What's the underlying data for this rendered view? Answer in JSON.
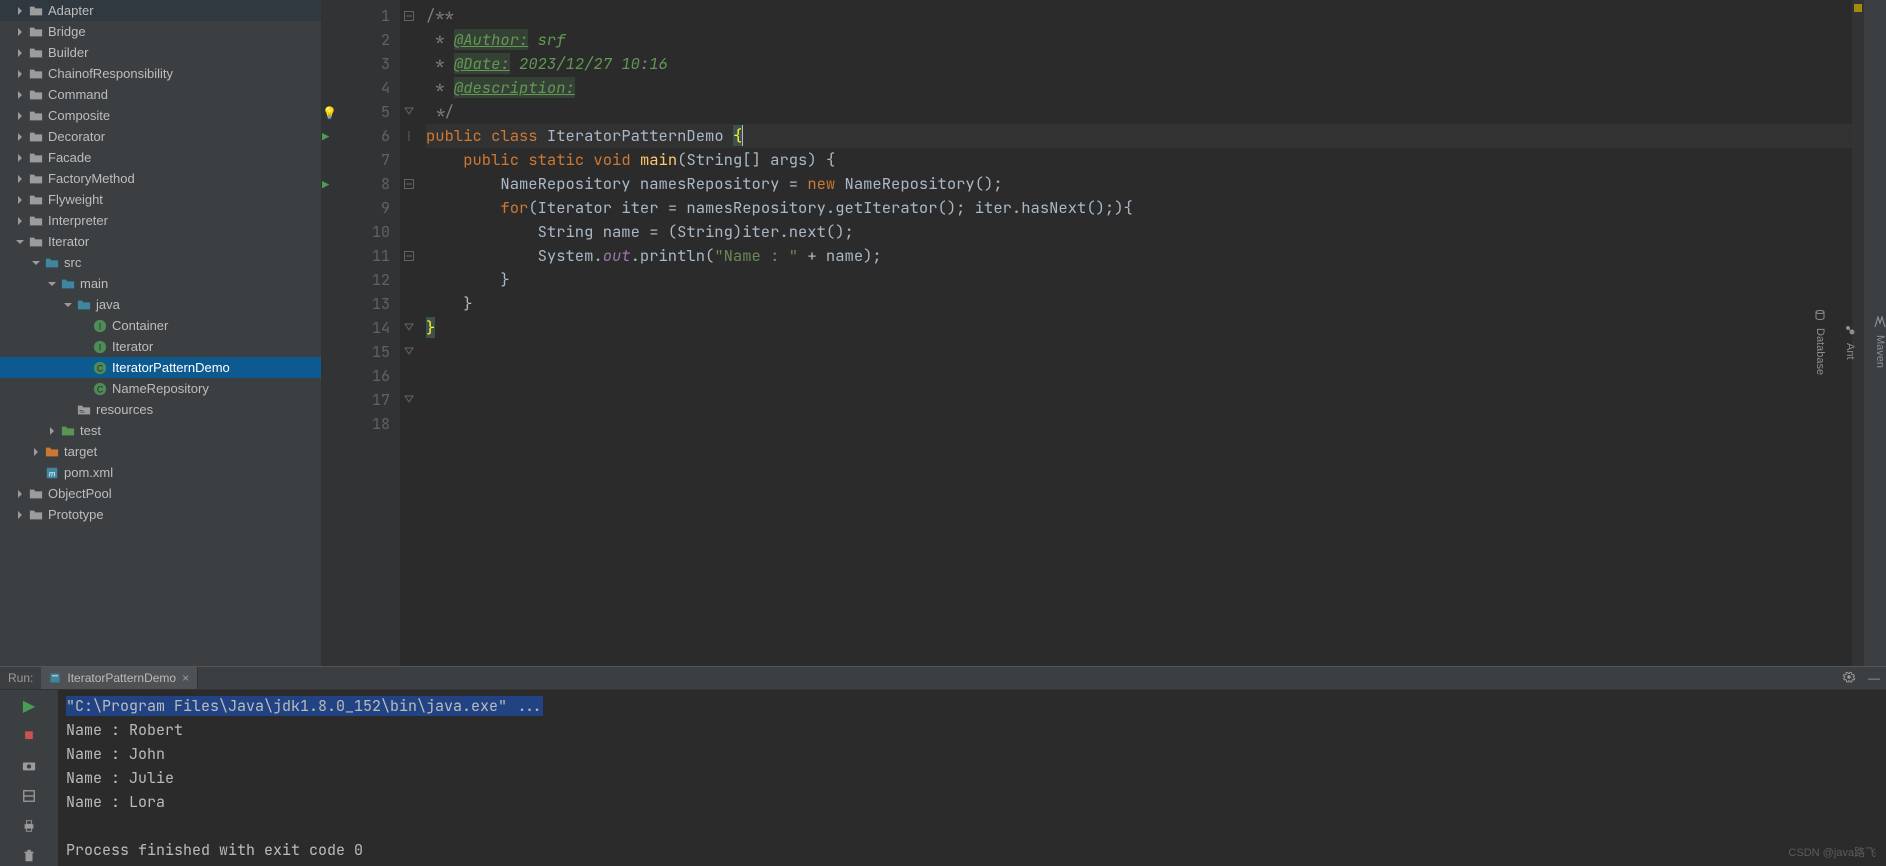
{
  "tree": [
    {
      "indent": 0,
      "arrow": "right",
      "icon": "folder",
      "label": "Adapter"
    },
    {
      "indent": 0,
      "arrow": "right",
      "icon": "folder",
      "label": "Bridge"
    },
    {
      "indent": 0,
      "arrow": "right",
      "icon": "folder",
      "label": "Builder"
    },
    {
      "indent": 0,
      "arrow": "right",
      "icon": "folder",
      "label": "ChainofResponsibility"
    },
    {
      "indent": 0,
      "arrow": "right",
      "icon": "folder",
      "label": "Command"
    },
    {
      "indent": 0,
      "arrow": "right",
      "icon": "folder",
      "label": "Composite"
    },
    {
      "indent": 0,
      "arrow": "right",
      "icon": "folder",
      "label": "Decorator"
    },
    {
      "indent": 0,
      "arrow": "right",
      "icon": "folder",
      "label": "Facade"
    },
    {
      "indent": 0,
      "arrow": "right",
      "icon": "folder",
      "label": "FactoryMethod"
    },
    {
      "indent": 0,
      "arrow": "right",
      "icon": "folder",
      "label": "Flyweight"
    },
    {
      "indent": 0,
      "arrow": "right",
      "icon": "folder",
      "label": "Interpreter"
    },
    {
      "indent": 0,
      "arrow": "down",
      "icon": "folder",
      "label": "Iterator"
    },
    {
      "indent": 1,
      "arrow": "down",
      "icon": "src",
      "label": "src"
    },
    {
      "indent": 2,
      "arrow": "down",
      "icon": "src",
      "label": "main"
    },
    {
      "indent": 3,
      "arrow": "down",
      "icon": "src",
      "label": "java"
    },
    {
      "indent": 4,
      "arrow": "none",
      "icon": "iface",
      "label": "Container"
    },
    {
      "indent": 4,
      "arrow": "none",
      "icon": "iface",
      "label": "Iterator"
    },
    {
      "indent": 4,
      "arrow": "none",
      "icon": "class",
      "label": "IteratorPatternDemo",
      "selected": true
    },
    {
      "indent": 4,
      "arrow": "none",
      "icon": "class",
      "label": "NameRepository"
    },
    {
      "indent": 3,
      "arrow": "none",
      "icon": "res",
      "label": "resources"
    },
    {
      "indent": 2,
      "arrow": "right",
      "icon": "test",
      "label": "test"
    },
    {
      "indent": 1,
      "arrow": "right",
      "icon": "target",
      "label": "target"
    },
    {
      "indent": 1,
      "arrow": "none",
      "icon": "pom",
      "label": "pom.xml"
    },
    {
      "indent": 0,
      "arrow": "right",
      "icon": "folder",
      "label": "ObjectPool"
    },
    {
      "indent": 0,
      "arrow": "right",
      "icon": "folder",
      "label": "Prototype"
    }
  ],
  "editor": {
    "line_numbers": [
      1,
      2,
      3,
      4,
      5,
      6,
      7,
      8,
      9,
      10,
      11,
      12,
      13,
      14,
      15,
      16,
      17,
      18
    ],
    "gutter_icons": {
      "5": "bulb",
      "6": "run",
      "8": "run"
    },
    "fold": {
      "1": "open",
      "5": "close",
      "6": "line",
      "8": "open",
      "11": "open",
      "14": "close",
      "15": "close",
      "17": "close"
    },
    "lines": [
      [
        {
          "t": "/**",
          "c": "cmt"
        }
      ],
      [
        {
          "t": " * ",
          "c": "cmt"
        },
        {
          "t": "@Author:",
          "c": "doc-tag"
        },
        {
          "t": " srf",
          "c": "doc-txt"
        }
      ],
      [
        {
          "t": " * ",
          "c": "cmt"
        },
        {
          "t": "@Date:",
          "c": "doc-tag"
        },
        {
          "t": " 2023/12/27 10:16",
          "c": "doc-txt"
        }
      ],
      [
        {
          "t": " * ",
          "c": "cmt"
        },
        {
          "t": "@description:",
          "c": "doc-tag"
        }
      ],
      [
        {
          "t": " */",
          "c": "cmt"
        }
      ],
      [
        {
          "t": "public ",
          "c": "kw"
        },
        {
          "t": "class ",
          "c": "kw"
        },
        {
          "t": "IteratorPatternDemo ",
          "c": "cls"
        },
        {
          "t": "{",
          "c": "br-hi caret"
        }
      ],
      [
        {
          "t": "",
          "c": "plain"
        }
      ],
      [
        {
          "t": "    public ",
          "c": "kw"
        },
        {
          "t": "static ",
          "c": "kw"
        },
        {
          "t": "void ",
          "c": "kw"
        },
        {
          "t": "main",
          "c": "mth"
        },
        {
          "t": "(String[] args) {",
          "c": "plain"
        }
      ],
      [
        {
          "t": "        NameRepository namesRepository = ",
          "c": "plain"
        },
        {
          "t": "new ",
          "c": "kw"
        },
        {
          "t": "NameRepository();",
          "c": "plain"
        }
      ],
      [
        {
          "t": "",
          "c": "plain"
        }
      ],
      [
        {
          "t": "        for",
          "c": "kw"
        },
        {
          "t": "(Iterator iter = namesRepository.getIterator(); iter.hasNext();){",
          "c": "plain"
        }
      ],
      [
        {
          "t": "            String name = (String)iter.next();",
          "c": "plain"
        }
      ],
      [
        {
          "t": "            System.",
          "c": "plain"
        },
        {
          "t": "out",
          "c": "fld"
        },
        {
          "t": ".println(",
          "c": "plain"
        },
        {
          "t": "\"Name : \" ",
          "c": "str"
        },
        {
          "t": "+ name);",
          "c": "plain"
        }
      ],
      [
        {
          "t": "        }",
          "c": "plain"
        }
      ],
      [
        {
          "t": "    }",
          "c": "plain"
        }
      ],
      [
        {
          "t": "",
          "c": "plain"
        }
      ],
      [
        {
          "t": "}",
          "c": "br-hi"
        }
      ],
      [
        {
          "t": "",
          "c": "plain"
        }
      ]
    ],
    "highlight_line": 6
  },
  "right_tools": [
    {
      "icon": "maven",
      "label": "Maven"
    },
    {
      "icon": "ant",
      "label": "Ant"
    },
    {
      "icon": "db",
      "label": "Database"
    }
  ],
  "run": {
    "label": "Run:",
    "tab": "IteratorPatternDemo",
    "lines": [
      {
        "text": "\"C:\\Program Files\\Java\\jdk1.8.0_152\\bin\\java.exe\" ...",
        "hl": true
      },
      {
        "text": "Name : Robert"
      },
      {
        "text": "Name : John"
      },
      {
        "text": "Name : Julie"
      },
      {
        "text": "Name : Lora"
      },
      {
        "text": ""
      },
      {
        "text": "Process finished with exit code 0"
      }
    ]
  },
  "watermark": "CSDN @java路飞"
}
